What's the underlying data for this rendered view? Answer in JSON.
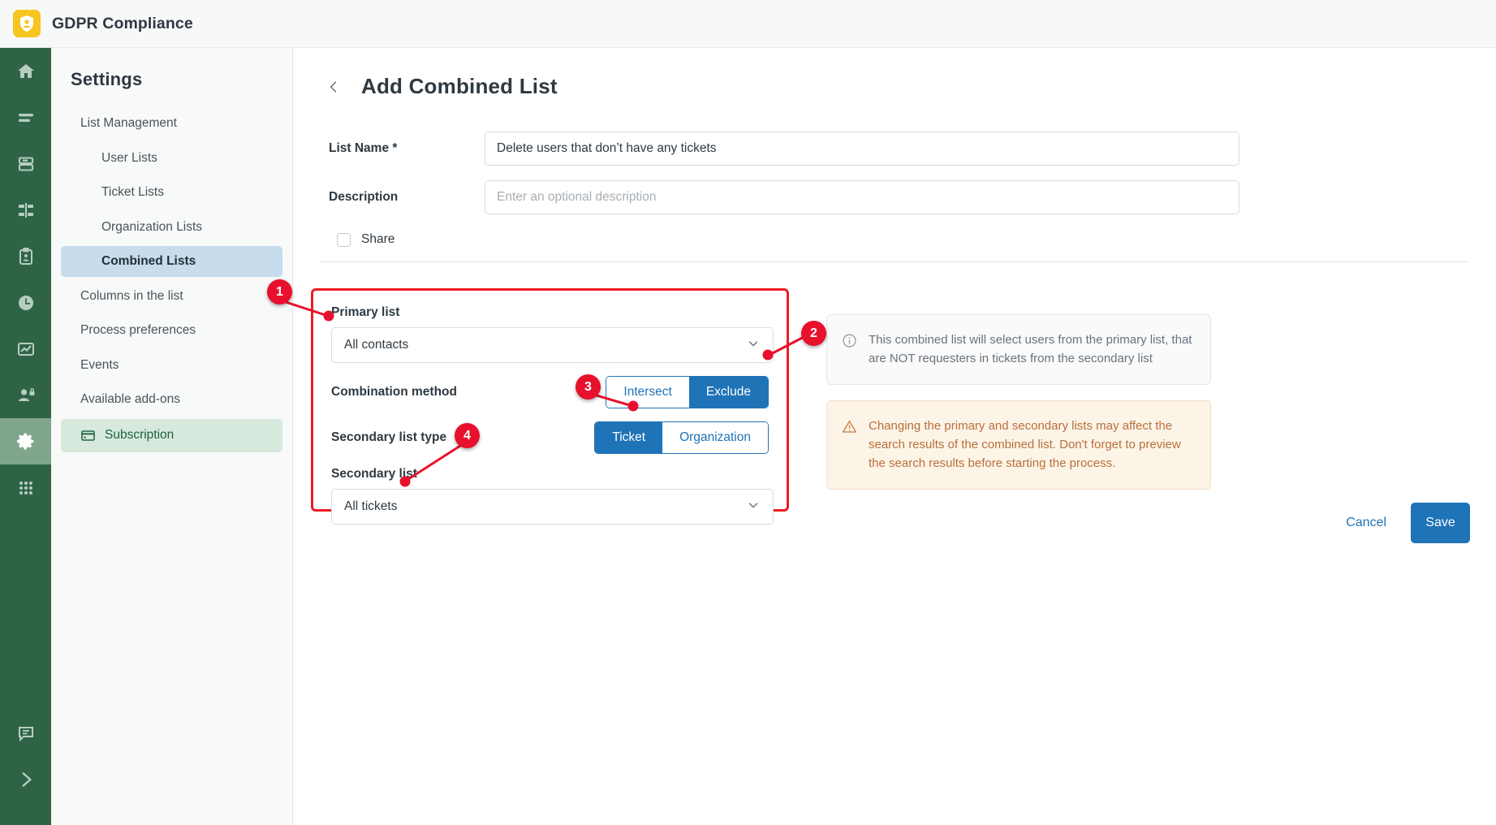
{
  "topbar": {
    "app_title": "GDPR Compliance",
    "logo_icon": "shield-user-icon",
    "brand_color": "#f7c521"
  },
  "rail": {
    "items": [
      {
        "icon": "home-icon",
        "name": "home",
        "active": false
      },
      {
        "icon": "lines-icon",
        "name": "views",
        "active": false
      },
      {
        "icon": "database-icon",
        "name": "data",
        "active": false
      },
      {
        "icon": "flow-icon",
        "name": "workflows",
        "active": false
      },
      {
        "icon": "clipboard-user-icon",
        "name": "requests",
        "active": false
      },
      {
        "icon": "clock-icon",
        "name": "history",
        "active": false
      },
      {
        "icon": "chart-icon",
        "name": "reports",
        "active": false
      },
      {
        "icon": "user-lock-icon",
        "name": "privacy",
        "active": false
      },
      {
        "icon": "gear-icon",
        "name": "settings",
        "active": true
      },
      {
        "icon": "grid-dots-icon",
        "name": "apps",
        "active": false
      }
    ],
    "bottom_items": [
      {
        "icon": "chat-icon",
        "name": "support"
      },
      {
        "icon": "chevron-right-icon",
        "name": "expand-rail"
      }
    ]
  },
  "settings": {
    "heading": "Settings",
    "nav": [
      {
        "label": "List Management",
        "level": 0,
        "state": "normal"
      },
      {
        "label": "User Lists",
        "level": 1,
        "state": "normal"
      },
      {
        "label": "Ticket Lists",
        "level": 1,
        "state": "normal"
      },
      {
        "label": "Organization Lists",
        "level": 1,
        "state": "normal"
      },
      {
        "label": "Combined Lists",
        "level": 1,
        "state": "selected"
      },
      {
        "label": "Columns in the list",
        "level": 0,
        "state": "normal"
      },
      {
        "label": "Process preferences",
        "level": 0,
        "state": "normal"
      },
      {
        "label": "Events",
        "level": 0,
        "state": "normal"
      },
      {
        "label": "Available add-ons",
        "level": 0,
        "state": "normal"
      },
      {
        "label": "Subscription",
        "level": 0,
        "state": "badge",
        "icon": "credit-card-icon"
      }
    ]
  },
  "page": {
    "back_icon": "chevron-left-icon",
    "title": "Add Combined List",
    "fields": {
      "list_name_label": "List Name *",
      "list_name_value": "Delete users that don’t have any tickets",
      "description_label": "Description",
      "description_value": "",
      "description_placeholder": "Enter an optional description",
      "share_label": "Share",
      "share_checked": false
    },
    "combination": {
      "primary_list_label": "Primary list",
      "primary_list_value": "All contacts",
      "combination_method_label": "Combination method",
      "combination_method_options": [
        "Intersect",
        "Exclude"
      ],
      "combination_method_selected": "Exclude",
      "secondary_list_type_label": "Secondary list type",
      "secondary_list_type_options": [
        "Ticket",
        "Organization"
      ],
      "secondary_list_type_selected": "Ticket",
      "secondary_list_label": "Secondary list",
      "secondary_list_value": "All tickets"
    },
    "info_box": {
      "icon": "info-circle-icon",
      "text": "This combined list will select users from the primary list, that are NOT requesters in tickets from the secondary list"
    },
    "warning_box": {
      "icon": "warning-triangle-icon",
      "text": "Changing the primary and secondary lists may affect the search results of the combined list. Don't forget to preview the search results before starting the process."
    },
    "actions": {
      "cancel_label": "Cancel",
      "save_label": "Save",
      "primary_color": "#1f73b7"
    }
  },
  "annotations": {
    "highlight_color": "#ed1c24",
    "markers": [
      {
        "number": "1",
        "target": "primary-list-select"
      },
      {
        "number": "2",
        "target": "combination-method-exclude"
      },
      {
        "number": "3",
        "target": "secondary-list-type-ticket"
      },
      {
        "number": "4",
        "target": "secondary-list-select"
      }
    ]
  }
}
